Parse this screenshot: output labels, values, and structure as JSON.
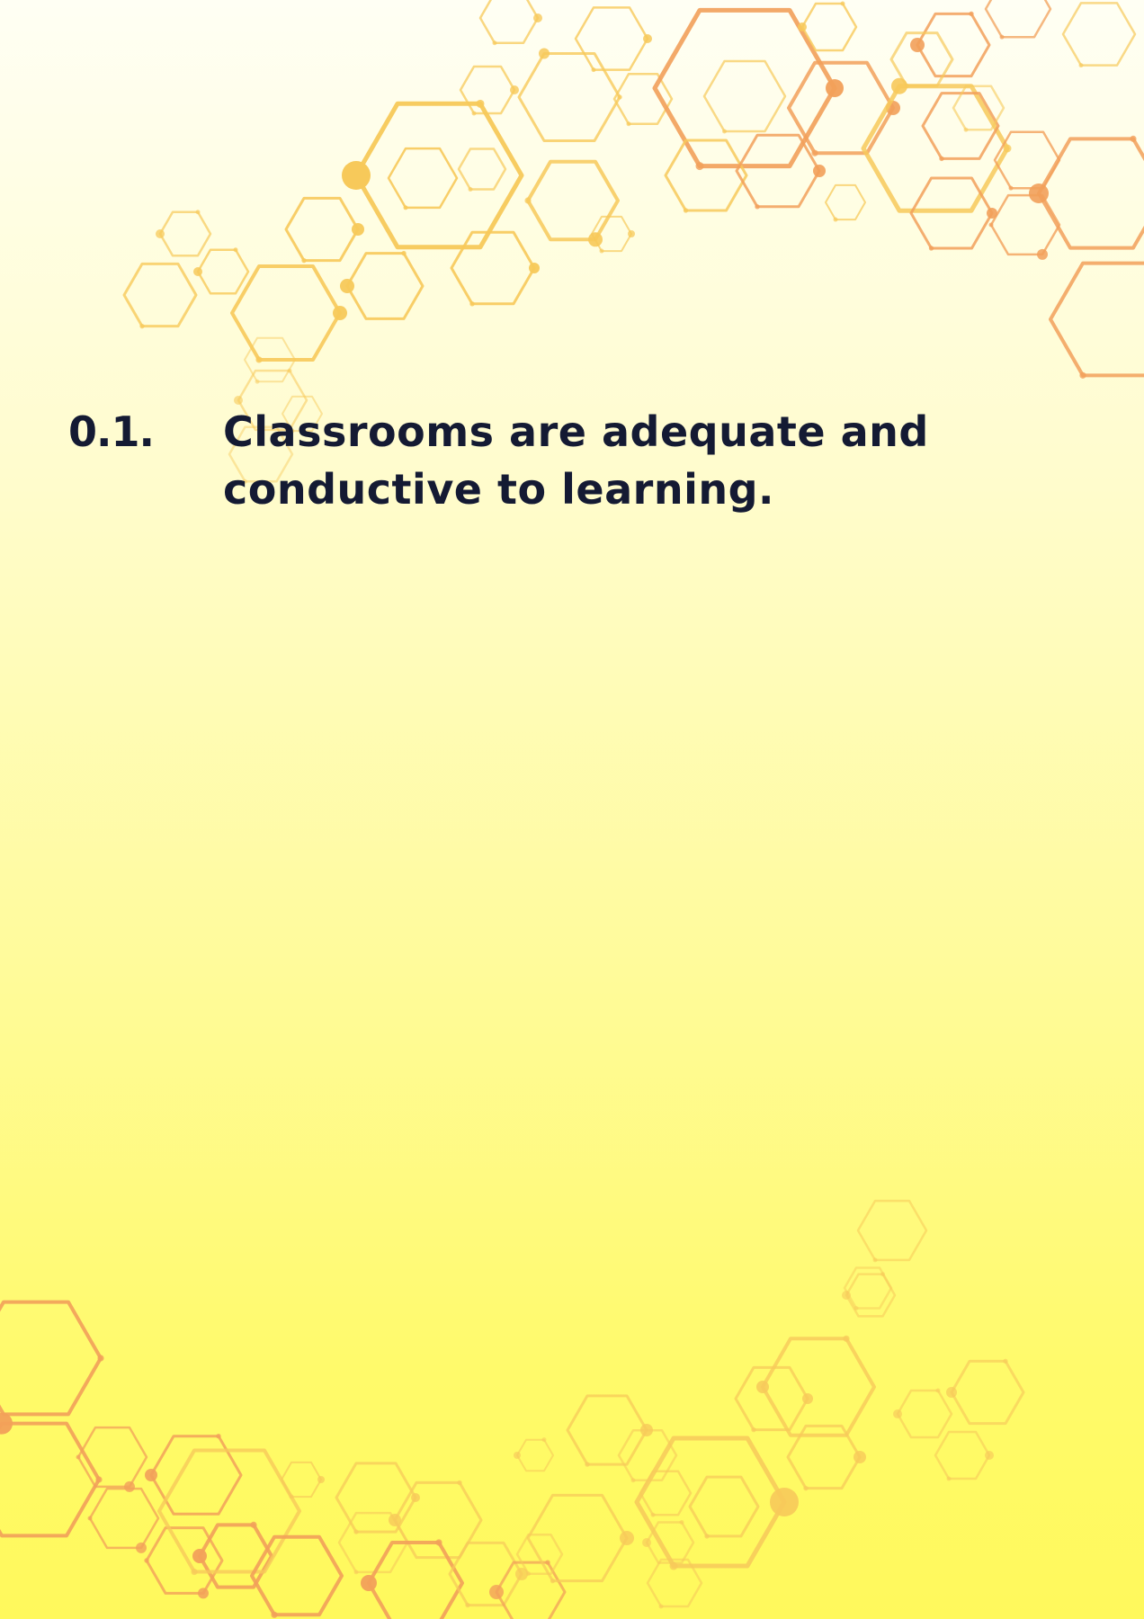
{
  "question": {
    "number": "0.1.",
    "line1": "Classrooms are adequate and",
    "line2": "conductive to learning."
  },
  "colors": {
    "text": "#141a33",
    "hex_light": "#f7c95a",
    "hex_orange": "#f2a05a",
    "background_top": "#fffff4",
    "background_bottom": "#fff95c"
  }
}
